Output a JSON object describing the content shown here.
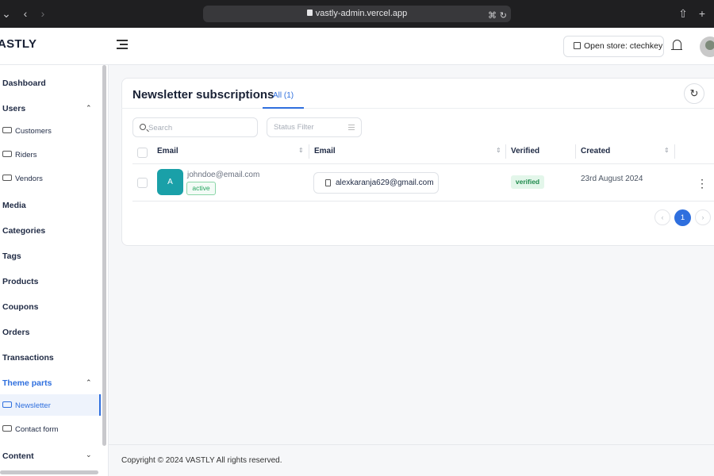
{
  "browser": {
    "url": "vastly-admin.vercel.app",
    "back_icon": "chevron-left-icon",
    "forward_icon": "chevron-right-icon",
    "share_icon": "share-icon",
    "new_tab_icon": "plus-icon"
  },
  "header": {
    "logo": "ASTLY",
    "menu_icon": "menu-collapse-icon",
    "open_store_label": "Open store: ctechkey",
    "notification_icon": "bell-icon"
  },
  "sidebar": {
    "items": [
      {
        "label": "Dashboard"
      },
      {
        "label": "Users",
        "expanded": true
      },
      {
        "label": "Customers",
        "icon": "user-plus-icon"
      },
      {
        "label": "Riders",
        "icon": "bike-icon"
      },
      {
        "label": "Vendors",
        "icon": "store-icon"
      },
      {
        "label": "Media"
      },
      {
        "label": "Categories"
      },
      {
        "label": "Tags"
      },
      {
        "label": "Products"
      },
      {
        "label": "Coupons"
      },
      {
        "label": "Orders"
      },
      {
        "label": "Transactions"
      },
      {
        "label": "Theme parts",
        "expanded": true,
        "accent": "#2f6fde"
      },
      {
        "label": "Newsletter",
        "icon": "newsletter-icon",
        "active": true
      },
      {
        "label": "Contact form",
        "icon": "mail-icon"
      },
      {
        "label": "Content",
        "expanded": false
      }
    ]
  },
  "page": {
    "title": "Newsletter subscriptions",
    "tabs": [
      {
        "label": "All (1)",
        "active": true
      }
    ],
    "refresh_icon": "refresh-icon"
  },
  "filters": {
    "search_placeholder": "Search",
    "status_filter_label": "Status Filter"
  },
  "table": {
    "columns": [
      "Email",
      "Email",
      "Verified",
      "Created"
    ],
    "rows": [
      {
        "avatar_letter": "A",
        "email": "johndoe@email.com",
        "status": "active",
        "contact_email": "alexkaranja629@gmail.com",
        "verified": "verified",
        "created": "23rd August 2024"
      }
    ]
  },
  "pagination": {
    "prev": "‹",
    "current": "1",
    "next": "›"
  },
  "footer": {
    "text": "Copyright © 2024 VASTLY All rights reserved."
  },
  "colors": {
    "accent": "#2f6fde",
    "avatar": "#1aa0a8",
    "success": "#22a45d"
  }
}
